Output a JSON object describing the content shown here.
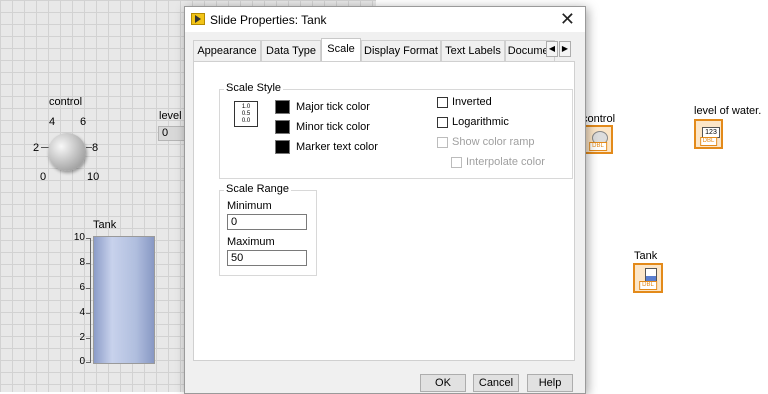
{
  "front_panel": {
    "knob": {
      "label": "control",
      "scale_labels": [
        "0",
        "2",
        "4",
        "6",
        "8",
        "10"
      ]
    },
    "level_indicator": {
      "label": "level o",
      "value": "0"
    },
    "tank": {
      "label": "Tank",
      "scale_labels": [
        "10",
        "8",
        "6",
        "4",
        "2",
        "0"
      ],
      "fill_fraction": 1.0
    }
  },
  "block_diagram": {
    "control_label": "control",
    "control_tag": "DBL",
    "level_label": "level of water.",
    "level_display": "123",
    "level_tag": "DBL",
    "tank_label": "Tank",
    "tank_tag": "DBL"
  },
  "dialog": {
    "title": "Slide Properties: Tank",
    "close_icon": "close-icon",
    "tabs": [
      "Appearance",
      "Data Type",
      "Scale",
      "Display Format",
      "Text Labels",
      "Documer"
    ],
    "active_tab": "Scale",
    "scroll_left_glyph": "◀",
    "scroll_right_glyph": "▶",
    "scale_style": {
      "title": "Scale Style",
      "icon_lines": [
        "1.0",
        "0.5",
        "0.0"
      ],
      "major_tick_label": "Major tick color",
      "minor_tick_label": "Minor tick color",
      "marker_text_label": "Marker text color",
      "major_tick_color": "#000000",
      "minor_tick_color": "#000000",
      "marker_text_color": "#000000",
      "inverted_label": "Inverted",
      "inverted_checked": false,
      "logarithmic_label": "Logarithmic",
      "logarithmic_checked": false,
      "show_color_ramp_label": "Show color ramp",
      "interpolate_color_label": "Interpolate color"
    },
    "scale_range": {
      "title": "Scale Range",
      "minimum_label": "Minimum",
      "minimum_value": "0",
      "maximum_label": "Maximum",
      "maximum_value": "50"
    },
    "buttons": {
      "ok": "OK",
      "cancel": "Cancel",
      "help": "Help"
    }
  }
}
